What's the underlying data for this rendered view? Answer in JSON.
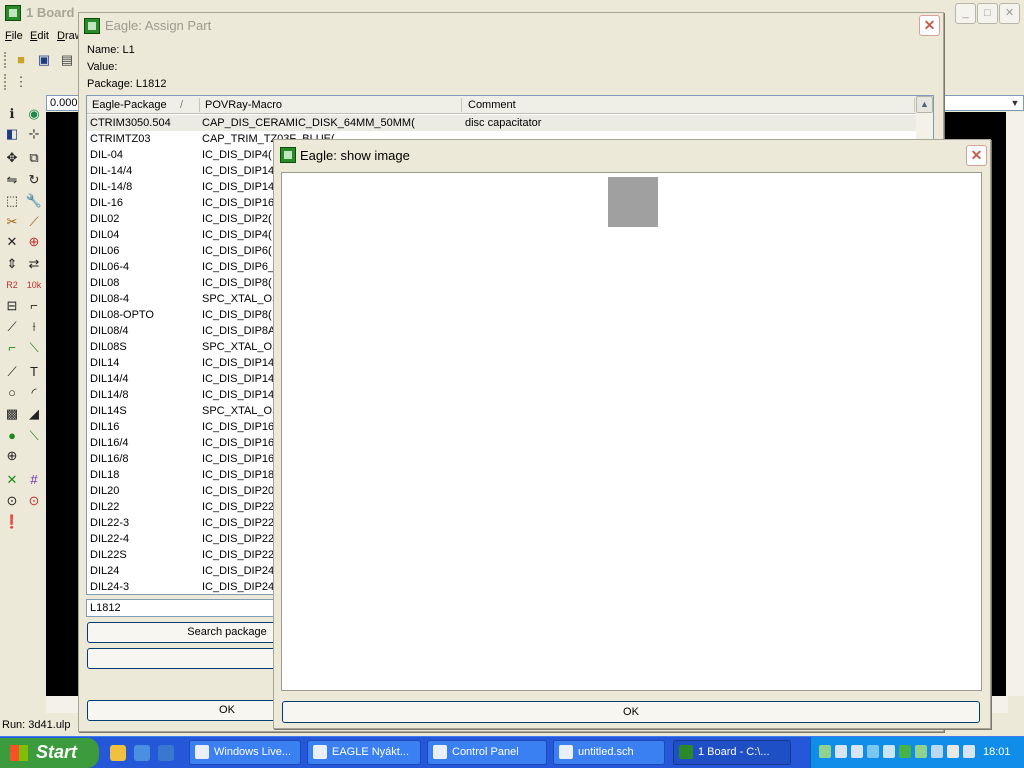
{
  "main": {
    "title": "1 Board",
    "menu": [
      "File",
      "Edit",
      "Draw"
    ],
    "coordinate": "0.000",
    "status": "Run: 3d41.ulp"
  },
  "assign": {
    "title": "Eagle: Assign Part",
    "name_label": "Name: L1",
    "value_label": "Value:",
    "package_label": "Package: L1812",
    "columns": [
      "Eagle-Package",
      "POVRay-Macro",
      "Comment"
    ],
    "rows": [
      [
        "CTRIM3050.504",
        "CAP_DIS_CERAMIC_DISK_64MM_50MM(",
        "disc capacitator"
      ],
      [
        "CTRIMTZ03",
        "CAP_TRIM_TZ03F_BLUE(",
        ""
      ],
      [
        "DIL-04",
        "IC_DIS_DIP4(",
        ""
      ],
      [
        "DIL-14/4",
        "IC_DIS_DIP14/",
        ""
      ],
      [
        "DIL-14/8",
        "IC_DIS_DIP14/",
        ""
      ],
      [
        "DIL-16",
        "IC_DIS_DIP16(",
        ""
      ],
      [
        "DIL02",
        "IC_DIS_DIP2(",
        ""
      ],
      [
        "DIL04",
        "IC_DIS_DIP4(",
        ""
      ],
      [
        "DIL06",
        "IC_DIS_DIP6(",
        ""
      ],
      [
        "DIL06-4",
        "IC_DIS_DIP6_",
        ""
      ],
      [
        "DIL08",
        "IC_DIS_DIP8(",
        ""
      ],
      [
        "DIL08-4",
        "SPC_XTAL_OS",
        ""
      ],
      [
        "DIL08-OPTO",
        "IC_DIS_DIP8(",
        ""
      ],
      [
        "DIL08/4",
        "IC_DIS_DIP8A",
        ""
      ],
      [
        "DIL08S",
        "SPC_XTAL_OS",
        ""
      ],
      [
        "DIL14",
        "IC_DIS_DIP14(",
        ""
      ],
      [
        "DIL14/4",
        "IC_DIS_DIP14/",
        ""
      ],
      [
        "DIL14/8",
        "IC_DIS_DIP14/",
        ""
      ],
      [
        "DIL14S",
        "SPC_XTAL_OS",
        ""
      ],
      [
        "DIL16",
        "IC_DIS_DIP16(",
        ""
      ],
      [
        "DIL16/4",
        "IC_DIS_DIP16/",
        ""
      ],
      [
        "DIL16/8",
        "IC_DIS_DIP16/",
        ""
      ],
      [
        "DIL18",
        "IC_DIS_DIP18(",
        ""
      ],
      [
        "DIL20",
        "IC_DIS_DIP20(",
        ""
      ],
      [
        "DIL22",
        "IC_DIS_DIP22(",
        ""
      ],
      [
        "DIL22-3",
        "IC_DIS_DIP22(",
        ""
      ],
      [
        "DIL22-4",
        "IC_DIS_DIP22(",
        ""
      ],
      [
        "DIL22S",
        "IC_DIS_DIP22(",
        ""
      ],
      [
        "DIL24",
        "IC_DIS_DIP24_",
        ""
      ],
      [
        "DIL24-3",
        "IC_DIS_DIP24(",
        ""
      ]
    ],
    "package_field": "L1812",
    "search_button": "Search package",
    "ok_button": "OK"
  },
  "show_image": {
    "title": "Eagle: show image",
    "ok_button": "OK"
  },
  "taskbar": {
    "start": "Start",
    "tasks": [
      "Windows Live...",
      "EAGLE Nyákt...",
      "Control Panel",
      "untitled.sch",
      "1 Board - C:\\..."
    ],
    "clock": "18:01"
  },
  "colors": {
    "taskbar": "#2458d8",
    "start": "#3c9b3c",
    "canvas": "#000000"
  }
}
